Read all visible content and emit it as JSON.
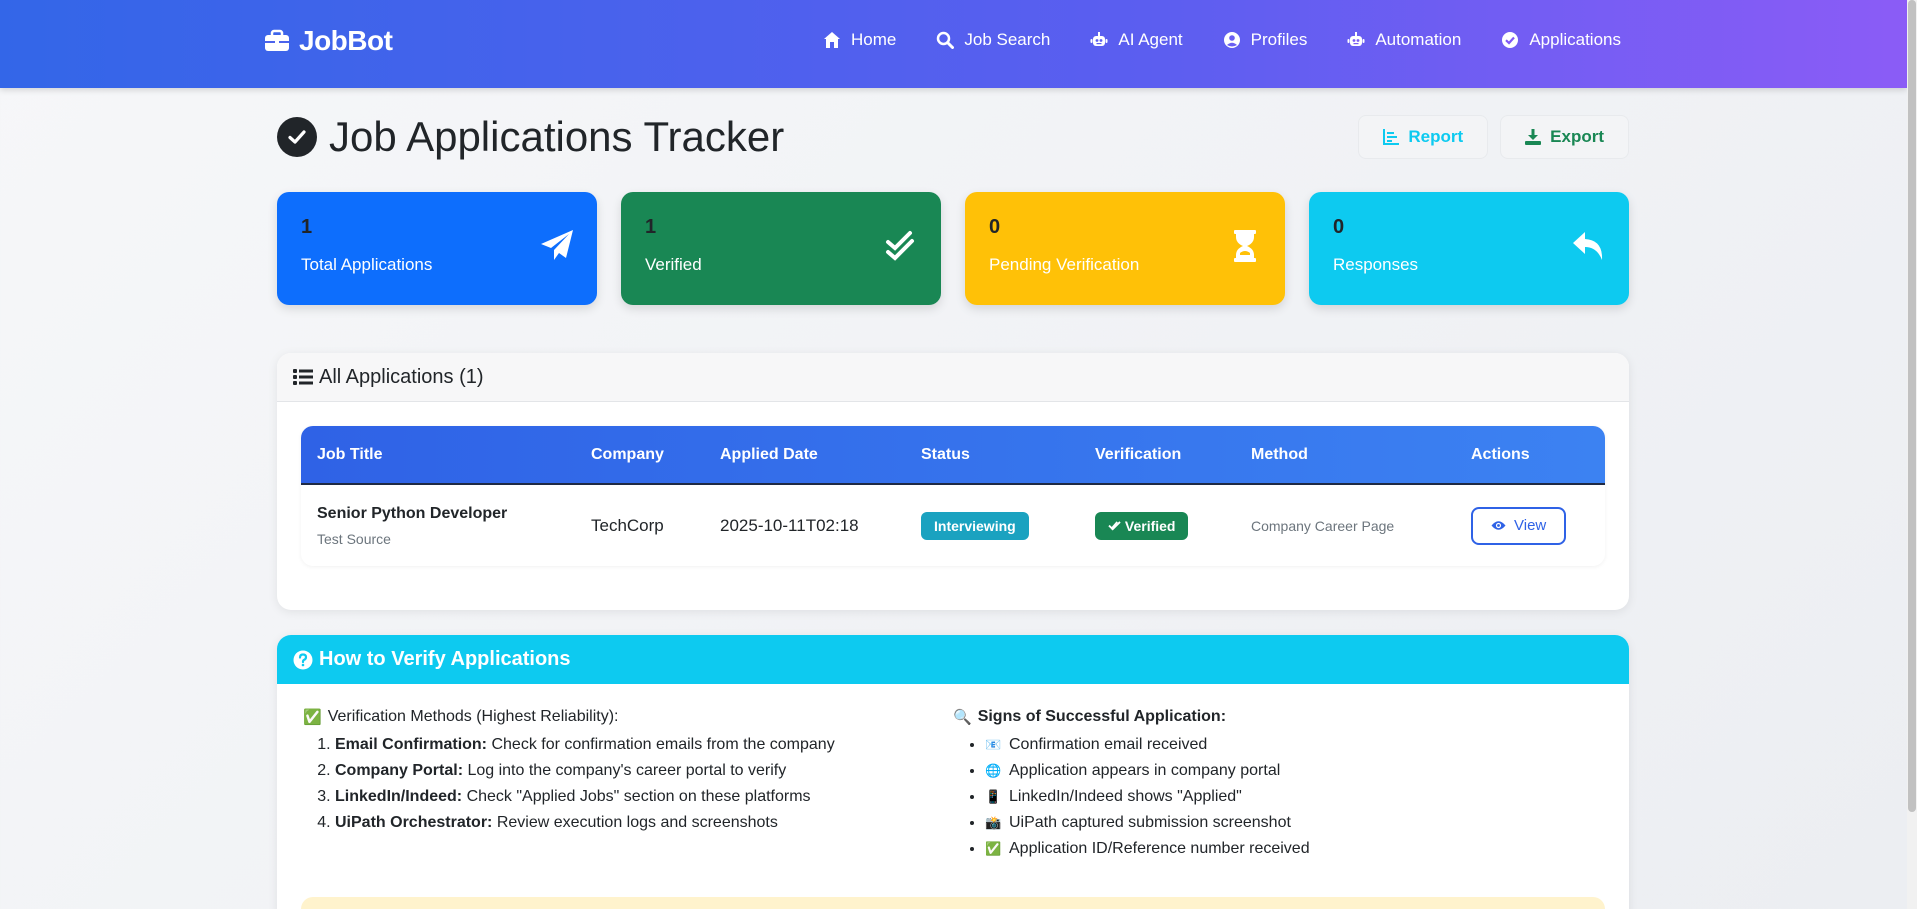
{
  "nav": {
    "brand": "JobBot",
    "links": [
      "Home",
      "Job Search",
      "AI Agent",
      "Profiles",
      "Automation",
      "Applications"
    ]
  },
  "header": {
    "title": "Job Applications Tracker",
    "report_label": "Report",
    "export_label": "Export"
  },
  "stats": [
    {
      "value": "1",
      "label": "Total Applications",
      "color": "#0d6efd",
      "icon": "paper-plane-icon"
    },
    {
      "value": "1",
      "label": "Verified",
      "color": "#198754",
      "icon": "double-check-icon"
    },
    {
      "value": "0",
      "label": "Pending Verification",
      "color": "#ffc107",
      "icon": "hourglass-icon"
    },
    {
      "value": "0",
      "label": "Responses",
      "color": "#0dcaf0",
      "icon": "reply-icon"
    }
  ],
  "applications": {
    "heading": "All Applications (1)",
    "columns": [
      "Job Title",
      "Company",
      "Applied Date",
      "Status",
      "Verification",
      "Method",
      "Actions"
    ],
    "rows": [
      {
        "title": "Senior Python Developer",
        "source": "Test Source",
        "company": "TechCorp",
        "date": "2025-10-11T02:18",
        "status": "Interviewing",
        "verification": "Verified",
        "method": "Company Career Page",
        "action": "View"
      }
    ]
  },
  "verify": {
    "heading": "How to Verify Applications",
    "methods_title": "Verification Methods (Highest Reliability):",
    "methods": [
      {
        "bold": "Email Confirmation:",
        "text": " Check for confirmation emails from the company"
      },
      {
        "bold": "Company Portal:",
        "text": " Log into the company's career portal to verify"
      },
      {
        "bold": "LinkedIn/Indeed:",
        "text": " Check \"Applied Jobs\" section on these platforms"
      },
      {
        "bold": "UiPath Orchestrator:",
        "text": " Review execution logs and screenshots"
      }
    ],
    "signs_title": "Signs of Successful Application:",
    "signs": [
      {
        "emoji": "📧",
        "text": "Confirmation email received"
      },
      {
        "emoji": "🌐",
        "text": "Application appears in company portal"
      },
      {
        "emoji": "📱",
        "text": "LinkedIn/Indeed shows \"Applied\""
      },
      {
        "emoji": "📸",
        "text": "UiPath captured submission screenshot"
      },
      {
        "emoji": "✅",
        "text": "Application ID/Reference number received"
      }
    ]
  }
}
